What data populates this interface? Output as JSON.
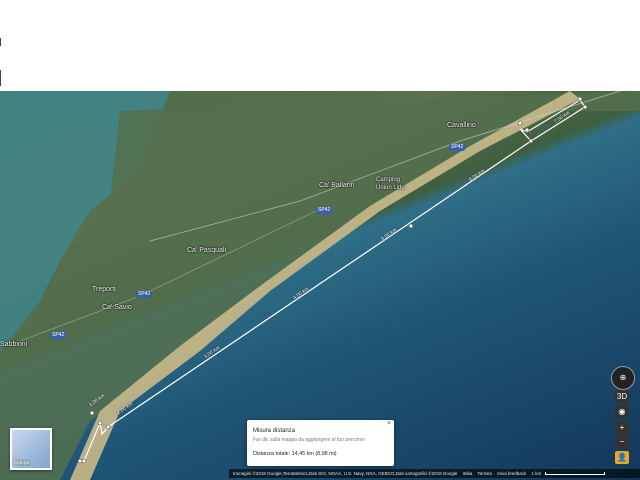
{
  "places": [
    {
      "name": "Cavallino"
    },
    {
      "name": "Ca' Ballarin"
    },
    {
      "name": "Camping Union Lido"
    },
    {
      "name": "Ca' Pasquali"
    },
    {
      "name": "Treporti"
    },
    {
      "name": "Ca' Savio"
    },
    {
      "name": "Sabbioni"
    },
    {
      "name": "SP42"
    }
  ],
  "ruler_labels": [
    "1,00 km",
    "2,00 km",
    "3,00 km",
    "4,00 km",
    "5,00 km",
    "6,00 km",
    "7,00 km"
  ],
  "panel": {
    "title": "Misura distanza",
    "hint": "Fai clic sulla mappa da aggiungere al tuo percorso",
    "total": "Distanza totale: 14,45 km (8,98 mi)",
    "close": "×"
  },
  "thumbnail": {
    "label": "Mappa"
  },
  "controls": {
    "compass": "⊕",
    "view3d": "3D",
    "zoom_in": "+",
    "zoom_out": "−",
    "locate": "◉",
    "pegman": "👤"
  },
  "footer": {
    "imagery": "Immagini ©2018 Google,TerraMetrics,Dati SIO, NOAA, U.S. Navy, NGA, GEBCO,Dati cartografici ©2018 Google",
    "country": "Italia",
    "terms": "Termini",
    "feedback": "Invia feedback",
    "scale": "1 km"
  },
  "colors": {
    "sea": "#1f5577",
    "land": "#4d6b4a",
    "beach": "#c9b98a",
    "ruler": "#ffffff"
  }
}
